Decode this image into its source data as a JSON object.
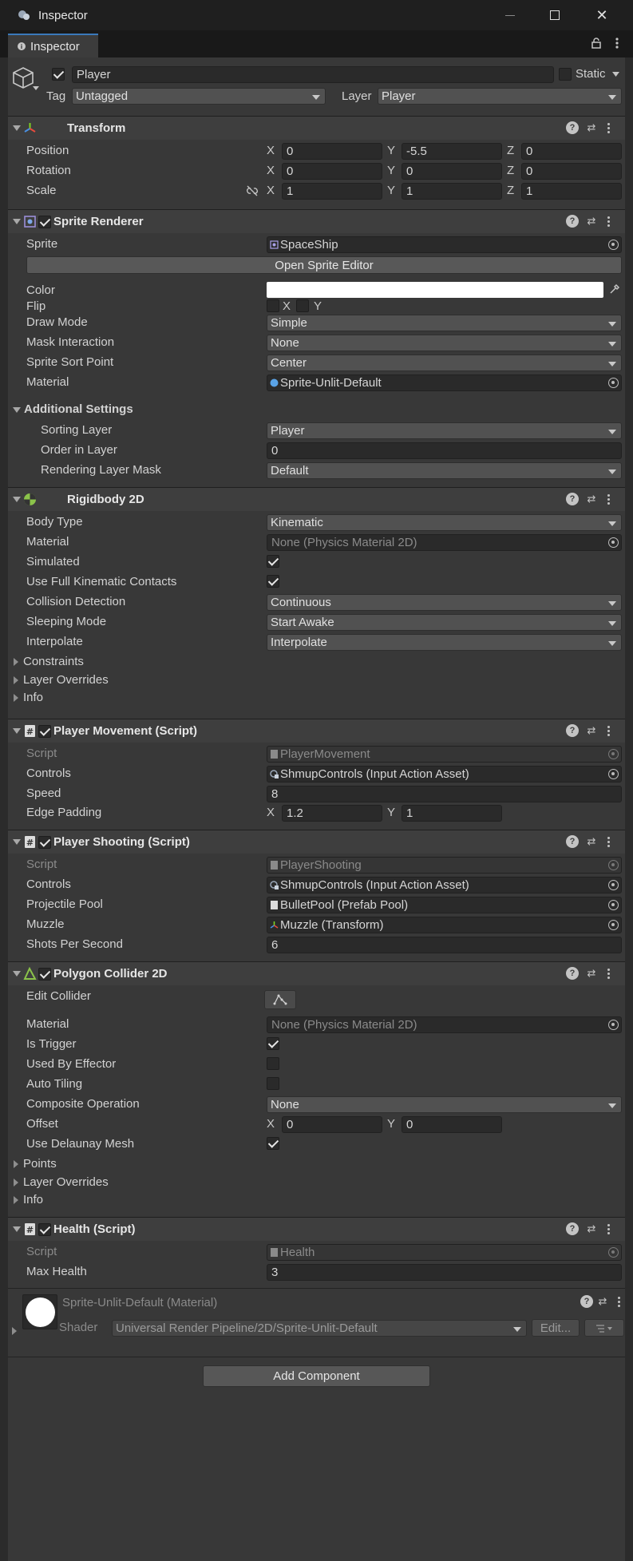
{
  "window": {
    "title": "Inspector"
  },
  "tab": {
    "label": "Inspector"
  },
  "gameobject": {
    "name": "Player",
    "active": true,
    "static_label": "Static",
    "tag_label": "Tag",
    "tag_value": "Untagged",
    "layer_label": "Layer",
    "layer_value": "Player"
  },
  "transform": {
    "title": "Transform",
    "position_label": "Position",
    "position": [
      "0",
      "-5.5",
      "0"
    ],
    "rotation_label": "Rotation",
    "rotation": [
      "0",
      "0",
      "0"
    ],
    "scale_label": "Scale",
    "scale": [
      "1",
      "1",
      "1"
    ],
    "axes": [
      "X",
      "Y",
      "Z"
    ]
  },
  "sprite_renderer": {
    "title": "Sprite Renderer",
    "sprite_label": "Sprite",
    "sprite_value": "SpaceShip",
    "open_editor": "Open Sprite Editor",
    "color_label": "Color",
    "color_value": "#ffffff",
    "flip_label": "Flip",
    "flip_x": "X",
    "flip_y": "Y",
    "draw_mode_label": "Draw Mode",
    "draw_mode": "Simple",
    "mask_label": "Mask Interaction",
    "mask": "None",
    "sort_point_label": "Sprite Sort Point",
    "sort_point": "Center",
    "material_label": "Material",
    "material": "Sprite-Unlit-Default",
    "additional_label": "Additional Settings",
    "sorting_layer_label": "Sorting Layer",
    "sorting_layer": "Player",
    "order_label": "Order in Layer",
    "order": "0",
    "rendering_mask_label": "Rendering Layer Mask",
    "rendering_mask": "Default"
  },
  "rigidbody": {
    "title": "Rigidbody 2D",
    "body_type_label": "Body Type",
    "body_type": "Kinematic",
    "material_label": "Material",
    "material": "None (Physics Material 2D)",
    "simulated_label": "Simulated",
    "full_kinematic_label": "Use Full Kinematic Contacts",
    "collision_label": "Collision Detection",
    "collision": "Continuous",
    "sleeping_label": "Sleeping Mode",
    "sleeping": "Start Awake",
    "interpolate_label": "Interpolate",
    "interpolate": "Interpolate",
    "constraints": "Constraints",
    "layer_overrides": "Layer Overrides",
    "info": "Info"
  },
  "player_movement": {
    "title": "Player Movement (Script)",
    "script_label": "Script",
    "script": "PlayerMovement",
    "controls_label": "Controls",
    "controls": "ShmupControls (Input Action Asset)",
    "speed_label": "Speed",
    "speed": "8",
    "edge_label": "Edge Padding",
    "edge_x": "1.2",
    "edge_y": "1"
  },
  "player_shooting": {
    "title": "Player Shooting (Script)",
    "script_label": "Script",
    "script": "PlayerShooting",
    "controls_label": "Controls",
    "controls": "ShmupControls (Input Action Asset)",
    "pool_label": "Projectile Pool",
    "pool": "BulletPool (Prefab Pool)",
    "muzzle_label": "Muzzle",
    "muzzle": "Muzzle (Transform)",
    "sps_label": "Shots Per Second",
    "sps": "6"
  },
  "polygon_collider": {
    "title": "Polygon Collider 2D",
    "edit_label": "Edit Collider",
    "material_label": "Material",
    "material": "None (Physics Material 2D)",
    "trigger_label": "Is Trigger",
    "effector_label": "Used By Effector",
    "tiling_label": "Auto Tiling",
    "composite_label": "Composite Operation",
    "composite": "None",
    "offset_label": "Offset",
    "offset_x": "0",
    "offset_y": "0",
    "delaunay_label": "Use Delaunay Mesh",
    "points": "Points",
    "layer_overrides": "Layer Overrides",
    "info": "Info"
  },
  "health": {
    "title": "Health (Script)",
    "script_label": "Script",
    "script": "Health",
    "max_label": "Max Health",
    "max": "3"
  },
  "material_preview": {
    "name": "Sprite-Unlit-Default (Material)",
    "shader_label": "Shader",
    "shader": "Universal Render Pipeline/2D/Sprite-Unlit-Default",
    "edit": "Edit..."
  },
  "add_component": "Add Component"
}
